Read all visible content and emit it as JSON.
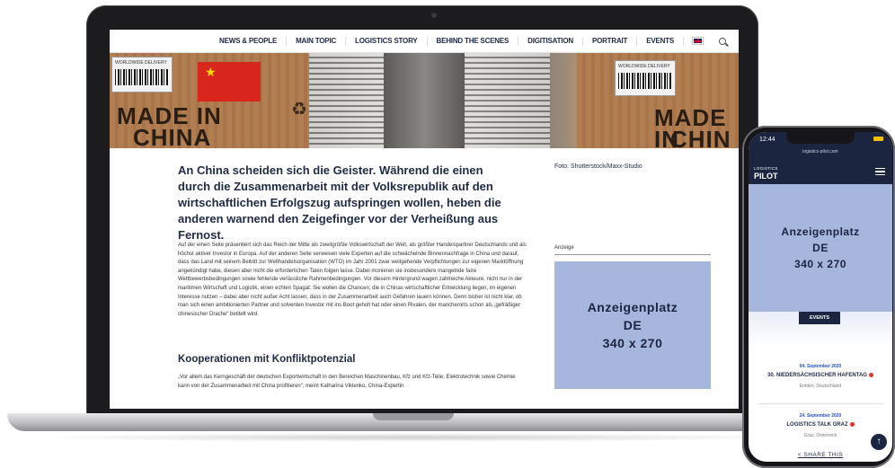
{
  "nav": {
    "items": [
      "NEWS & PEOPLE",
      "MAIN TOPIC",
      "LOGISTICS STORY",
      "BEHIND THE SCENES",
      "DIGITISATION",
      "PORTRAIT",
      "EVENTS"
    ]
  },
  "hero": {
    "made_left": "MADE IN",
    "china_left": "CHINA",
    "made_right": "MADE IN",
    "china_right": "CHIN",
    "label_text": "WORLDWIDE DELIVERY"
  },
  "article": {
    "lead": "An China scheiden sich die Geister. Während die einen durch die Zusammenarbeit mit der Volksrepublik auf den wirtschaftlichen Erfolgszug aufspringen wollen, heben die anderen warnend den Zeigefinger vor der Verheißung aus Fernost.",
    "photo_credit": "Foto: Shutterstock/Maxx-Studio",
    "body": "Auf der einen Seite präsentiert sich das Reich der Mitte als zweitgrößte Volkswirtschaft der Welt, als größter Handelspartner Deutschlands und als höchst aktiver Investor in Europa. Auf der anderen Seite verweisen viele Experten auf die schwächelnde Binnennachfrage in China und darauf, dass das Land mit seinem Beitritt zur Welthandelsorganisation (WTO) im Jahr 2001 zwar weitgehende Verpflichtungen zur eigenen Marktöffnung angekündigt habe, diesen aber nicht die erforderlichen Taten folgen lasse. Dabei monieren sie insbesondere mangelnde faire Wettbewerbsbedingungen sowie fehlende verlässliche Rahmenbedingungen. Vor diesem Hintergrund wagen zahlreiche Akteure, nicht nur in der maritimen Wirtschaft und Logistik, einen echten Spagat: Sie wollen die Chancen, die in Chinas wirtschaftlicher Entwicklung liegen, im eigenen Interesse nutzen – dabei aber nicht außer Acht lassen, dass in der Zusammenarbeit auch Gefahren lauern können. Denn bisher ist nicht klar, ob man sich einen ambitionierten Partner und solventen Investor mit ins Boot geholt hat oder einen Rivalen, der mancherorts schon als „gefräßiger chinesischer Drache“ betitelt wird.",
    "subheading": "Kooperationen mit Konfliktpotenzial",
    "quote": "„Vor allem das Kerngeschäft der deutschen Exportwirtschaft in den Bereichen Maschinenbau, Kfz und Kfz-Teile, Elektrotechnik sowie Chemie kann von der Zusammenarbeit mit China profitieren“, meint Katharina Viklenko, China-Expertin"
  },
  "sidebar": {
    "ad_caption": "Anzeige",
    "ad_line1": "Anzeigenplatz",
    "ad_line2": "DE",
    "ad_line3": "340 x 270"
  },
  "phone": {
    "time": "12:44",
    "url": "logistics-pilot.com",
    "logo_top": "LOGISTICS",
    "logo_bottom": "PILOT",
    "ad_line1": "Anzeigenplatz",
    "ad_line2": "DE",
    "ad_line3": "340 x 270",
    "events_label": "EVENTS",
    "events": [
      {
        "date": "04. September 2020",
        "title": "30. NIEDERSÄCHSISCHER HAFENTAG",
        "place": "Emden, Deutschland"
      },
      {
        "date": "24. September 2020",
        "title": "LOGISTICS TALK GRAZ",
        "place": "Graz, Österreich"
      }
    ],
    "share_label": "SHARE THIS"
  },
  "colors": {
    "navy": "#1b2540",
    "ad_blue": "#a7b6dd",
    "event_dot": "#e0322d",
    "event_date": "#2a52be"
  },
  "icons": [
    "uk-flag-icon",
    "search-icon",
    "menu-icon",
    "battery-icon",
    "arrow-up-icon",
    "share-icon",
    "recycle-icon"
  ]
}
